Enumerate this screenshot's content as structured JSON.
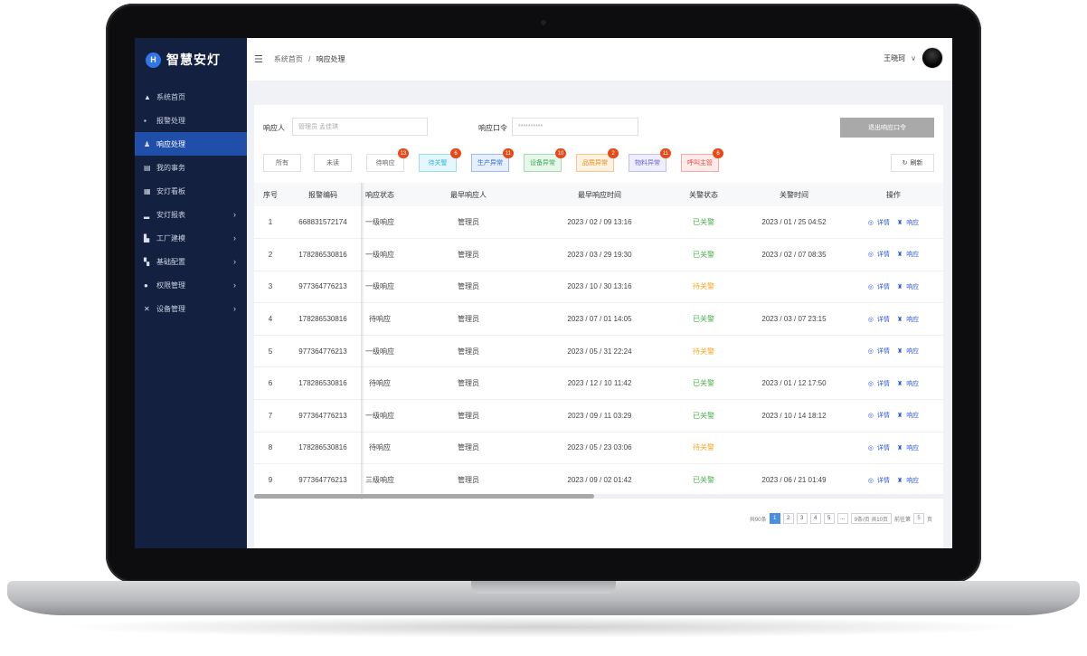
{
  "app": {
    "name": "智慧安灯",
    "logo_letter": "H"
  },
  "sidebar": {
    "items": [
      {
        "label": "系统首页",
        "icon": "home-icon",
        "glyph": "▲",
        "has_children": false,
        "active": false
      },
      {
        "label": "报警处理",
        "icon": "alarm-icon",
        "glyph": "▪",
        "has_children": false,
        "active": false
      },
      {
        "label": "响应处理",
        "icon": "user-response-icon",
        "glyph": "♟",
        "has_children": false,
        "active": true
      },
      {
        "label": "我的事务",
        "icon": "document-icon",
        "glyph": "▤",
        "has_children": false,
        "active": false
      },
      {
        "label": "安灯看板",
        "icon": "board-icon",
        "glyph": "▦",
        "has_children": false,
        "active": false
      },
      {
        "label": "安灯报表",
        "icon": "bar-chart-icon",
        "glyph": "▂",
        "has_children": true,
        "active": false
      },
      {
        "label": "工厂建模",
        "icon": "factory-icon",
        "glyph": "▙",
        "has_children": true,
        "active": false
      },
      {
        "label": "基础配置",
        "icon": "grid-icon",
        "glyph": "▚",
        "has_children": true,
        "active": false
      },
      {
        "label": "权限管理",
        "icon": "location-pin-icon",
        "glyph": "●",
        "has_children": true,
        "active": false
      },
      {
        "label": "设备管理",
        "icon": "tools-icon",
        "glyph": "✕",
        "has_children": true,
        "active": false
      }
    ],
    "chevron": "›"
  },
  "header": {
    "menu_icon": "☰",
    "breadcrumb_home": "系统首页",
    "breadcrumb_sep": "/",
    "breadcrumb_current": "响应处理",
    "user_name": "王晓珂",
    "user_chevron": "∨"
  },
  "filters": {
    "responder_label": "响应人",
    "responder_value": "管理员 孟佳琪",
    "password_label": "响应口令",
    "password_value": "**********",
    "exit_button": "退出响应口令"
  },
  "tabs": [
    {
      "label": "所有",
      "badge": "",
      "color": "#666666",
      "bg": "#ffffff",
      "border": "#dcdfe6"
    },
    {
      "label": "未读",
      "badge": "",
      "color": "#666666",
      "bg": "#ffffff",
      "border": "#dcdfe6"
    },
    {
      "label": "待响应",
      "badge": "13",
      "color": "#666666",
      "bg": "#ffffff",
      "border": "#dcdfe6"
    },
    {
      "label": "待关警",
      "badge": "6",
      "color": "#2eb6e0",
      "bg": "#e6f7fc",
      "border": "#9ddcf0"
    },
    {
      "label": "生产异常",
      "badge": "11",
      "color": "#2f6fd0",
      "bg": "#e5efff",
      "border": "#9dbcee"
    },
    {
      "label": "设备异常",
      "badge": "10",
      "color": "#3aa853",
      "bg": "#e8f7ec",
      "border": "#a5dcb3"
    },
    {
      "label": "品质异常",
      "badge": "2",
      "color": "#e88a1a",
      "bg": "#fff2e2",
      "border": "#f3c98e"
    },
    {
      "label": "物料异常",
      "badge": "11",
      "color": "#6b63c8",
      "bg": "#efeeff",
      "border": "#c3bef0"
    },
    {
      "label": "呼叫主管",
      "badge": "6",
      "color": "#e0473a",
      "bg": "#ffecea",
      "border": "#f2aaa4"
    }
  ],
  "refresh_label": "刷新",
  "table": {
    "columns": [
      "序号",
      "报警编码",
      "响应状态",
      "最早响应人",
      "最早响应时间",
      "关警状态",
      "关警时间",
      "操作"
    ],
    "rows": [
      {
        "no": "1",
        "code": "668831572174",
        "state": "一级响应",
        "responder": "管理员",
        "time": "2023 / 02 / 09 13:16",
        "close_state": "已关警",
        "close_time": "2023 / 01 / 25 04:52"
      },
      {
        "no": "2",
        "code": "178286530816",
        "state": "一级响应",
        "responder": "管理员",
        "time": "2023 / 03 / 29 19:30",
        "close_state": "已关警",
        "close_time": "2023 / 02 / 07 08:35"
      },
      {
        "no": "3",
        "code": "977364776213",
        "state": "一级响应",
        "responder": "管理员",
        "time": "2023 / 10 / 30 13:16",
        "close_state": "待关警",
        "close_time": ""
      },
      {
        "no": "4",
        "code": "178286530816",
        "state": "待响应",
        "responder": "管理员",
        "time": "2023 / 07 / 01 14:05",
        "close_state": "已关警",
        "close_time": "2023 / 03 / 07 23:15"
      },
      {
        "no": "5",
        "code": "977364776213",
        "state": "一级响应",
        "responder": "管理员",
        "time": "2023 / 05 / 31 22:24",
        "close_state": "待关警",
        "close_time": ""
      },
      {
        "no": "6",
        "code": "178286530816",
        "state": "待响应",
        "responder": "管理员",
        "time": "2023 / 12 / 10 11:42",
        "close_state": "已关警",
        "close_time": "2023 / 01 / 12 17:50"
      },
      {
        "no": "7",
        "code": "977364776213",
        "state": "一级响应",
        "responder": "管理员",
        "time": "2023 / 09 / 11 03:29",
        "close_state": "已关警",
        "close_time": "2023 / 10 / 14 18:12"
      },
      {
        "no": "8",
        "code": "178286530816",
        "state": "待响应",
        "responder": "管理员",
        "time": "2023 / 05 / 23 03:06",
        "close_state": "待关警",
        "close_time": ""
      },
      {
        "no": "9",
        "code": "977364776213",
        "state": "三级响应",
        "responder": "管理员",
        "time": "2023 / 09 / 02 01:42",
        "close_state": "已关警",
        "close_time": "2023 / 06 / 21 01:49"
      }
    ],
    "op_detail": "详情",
    "op_respond": "响应",
    "status_colors": {
      "已关警": "#4caf50",
      "待关警": "#f5a623"
    }
  },
  "pagination": {
    "total": "共90条",
    "pages": [
      "1",
      "2",
      "3",
      "4",
      "5",
      "..."
    ],
    "current": "1",
    "page_size": "9条/页 共10页",
    "goto_label": "前往第",
    "goto_value": "5",
    "goto_suffix": "页"
  }
}
